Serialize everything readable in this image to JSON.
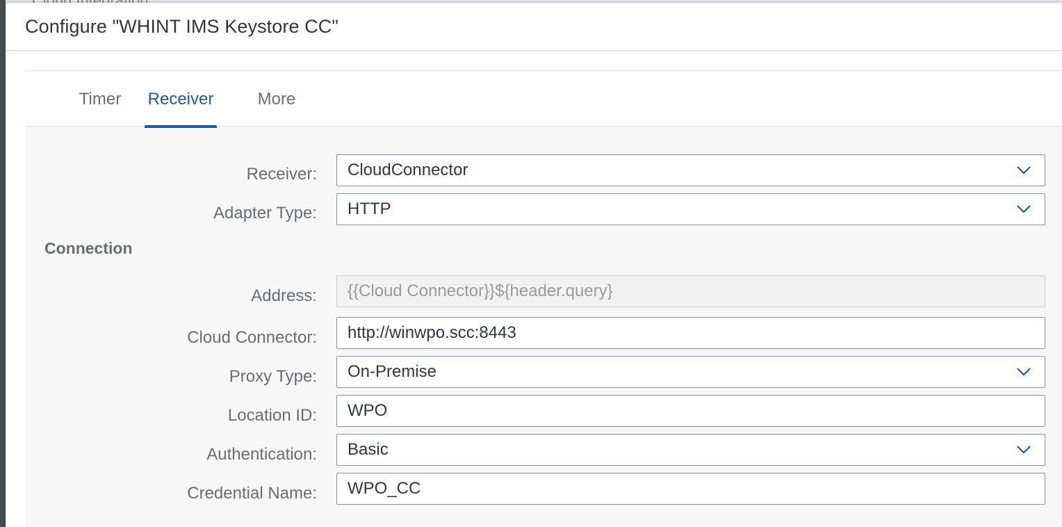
{
  "background": {
    "title": "Cloud Integration"
  },
  "dialog": {
    "title": "Configure \"WHINT IMS Keystore CC\""
  },
  "tabs": [
    {
      "label": "Timer",
      "active": false
    },
    {
      "label": "Receiver",
      "active": true
    },
    {
      "label": "More",
      "active": false
    }
  ],
  "form": {
    "receiver": {
      "label": "Receiver:",
      "value": "CloudConnector"
    },
    "adapter_type": {
      "label": "Adapter Type:",
      "value": "HTTP"
    },
    "connection_section": "Connection",
    "address": {
      "label": "Address:",
      "value": "{{Cloud Connector}}${header.query}"
    },
    "cloud_connector": {
      "label": "Cloud Connector:",
      "value": "http://winwpo.scc:8443"
    },
    "proxy_type": {
      "label": "Proxy Type:",
      "value": "On-Premise"
    },
    "location_id": {
      "label": "Location ID:",
      "value": "WPO"
    },
    "authentication": {
      "label": "Authentication:",
      "value": "Basic"
    },
    "credential_name": {
      "label": "Credential Name:",
      "value": "WPO_CC"
    }
  },
  "colors": {
    "accent": "#1d5c9b",
    "label": "#6a6d70",
    "text": "#32363a",
    "field_border": "#89919a",
    "content_bg": "#f7f7f7"
  },
  "icons": {
    "dropdown": "chevron-down-icon"
  }
}
